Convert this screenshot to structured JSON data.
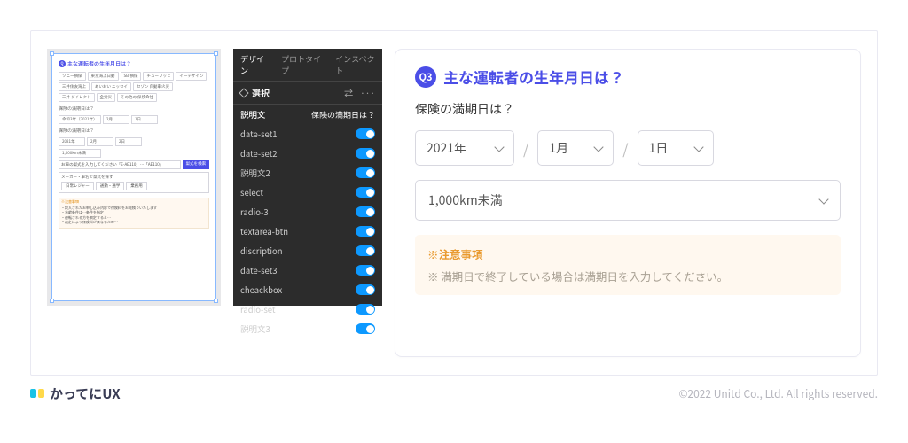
{
  "preview": {
    "q_title": "主な運転者の生年月日は？",
    "companies": [
      "ソニー損保",
      "東京海上日動",
      "SBI損保",
      "チューリッヒ",
      "イーデザイン",
      "三井住友海上",
      "あいおい\nニッセイ",
      "セゾン\n自動車火災",
      "三井\nダイレクト",
      "全労災",
      "その他の\n保険会社"
    ],
    "section1_label": "保険の満期日は？",
    "era_selects": [
      "令和3年（2021年）",
      "2月",
      "1日"
    ],
    "section2_label": "保険の満期日は？",
    "date_selects": [
      "2021年",
      "2月",
      "2日"
    ],
    "distance": "1,000km未満",
    "car_input_label": "お車の型式を入力してください「E-AE110」…「AE110」",
    "car_btn": "型式を検索",
    "box_label": "メーカー・車名で型式を探す",
    "tabs": [
      "日常レジャー",
      "通勤・通学",
      "業務用"
    ],
    "notice_title": "※注意事項",
    "notice_lines": [
      "・記入されたお申し込み内容で保険料をお見積りいたします",
      "・年齢条件は…条件を指定",
      "・運転される方を限定すると…",
      "・設定により保険料が異なるため…"
    ]
  },
  "inspector": {
    "tabs": [
      "デザイン",
      "プロトタイプ",
      "インスペクト"
    ],
    "active_tab": 0,
    "section": "選択",
    "header_label": "説明文",
    "header_value": "保険の満期日は？",
    "items": [
      "date-set1",
      "date-set2",
      "説明文2",
      "select",
      "radio-3",
      "textarea-btn",
      "discription",
      "date-set3",
      "cheackbox",
      "radio-set",
      "説明文3"
    ]
  },
  "form": {
    "q_num": "Q3",
    "q_text": "主な運転者の生年月日は？",
    "sub": "保険の満期日は？",
    "year": "2021年",
    "month": "1月",
    "day": "1日",
    "distance": "1,000km未満",
    "notice_title": "※注意事項",
    "notice_body": "※ 満期日で終了している場合は満期日を入力してください。"
  },
  "footer": {
    "brand": "かってにUX",
    "copyright": "©2022 Unitd Co., Ltd. All rights reserved."
  }
}
